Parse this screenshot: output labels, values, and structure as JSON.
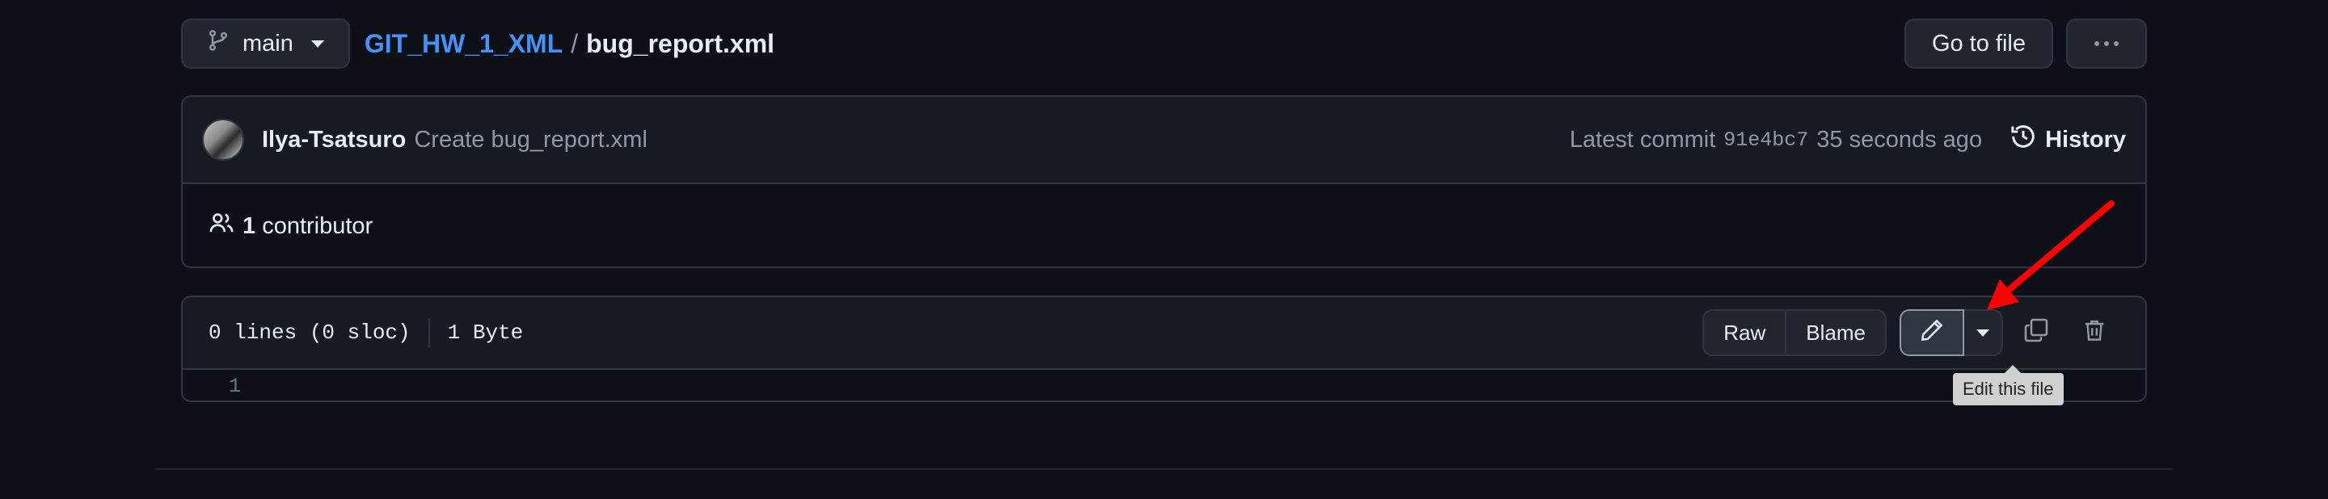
{
  "header": {
    "branch_label": "main",
    "repo_name": "GIT_HW_1_XML",
    "separator": "/",
    "file_name": "bug_report.xml",
    "go_to_file_label": "Go to file"
  },
  "commit": {
    "author": "Ilya-Tsatsuro",
    "message": "Create bug_report.xml",
    "latest_label": "Latest commit",
    "hash": "91e4bc7",
    "time_ago": "35 seconds ago",
    "history_label": "History"
  },
  "contributors": {
    "count": "1",
    "label": "contributor"
  },
  "file": {
    "lines_info": "0 lines (0 sloc)",
    "size": "1 Byte",
    "raw_label": "Raw",
    "blame_label": "Blame",
    "line_numbers": [
      "1"
    ]
  },
  "tooltip": {
    "text": "Edit this file"
  },
  "colors": {
    "background": "#0d1117",
    "link": "#4493f8",
    "annotation_arrow": "#ff0000"
  }
}
